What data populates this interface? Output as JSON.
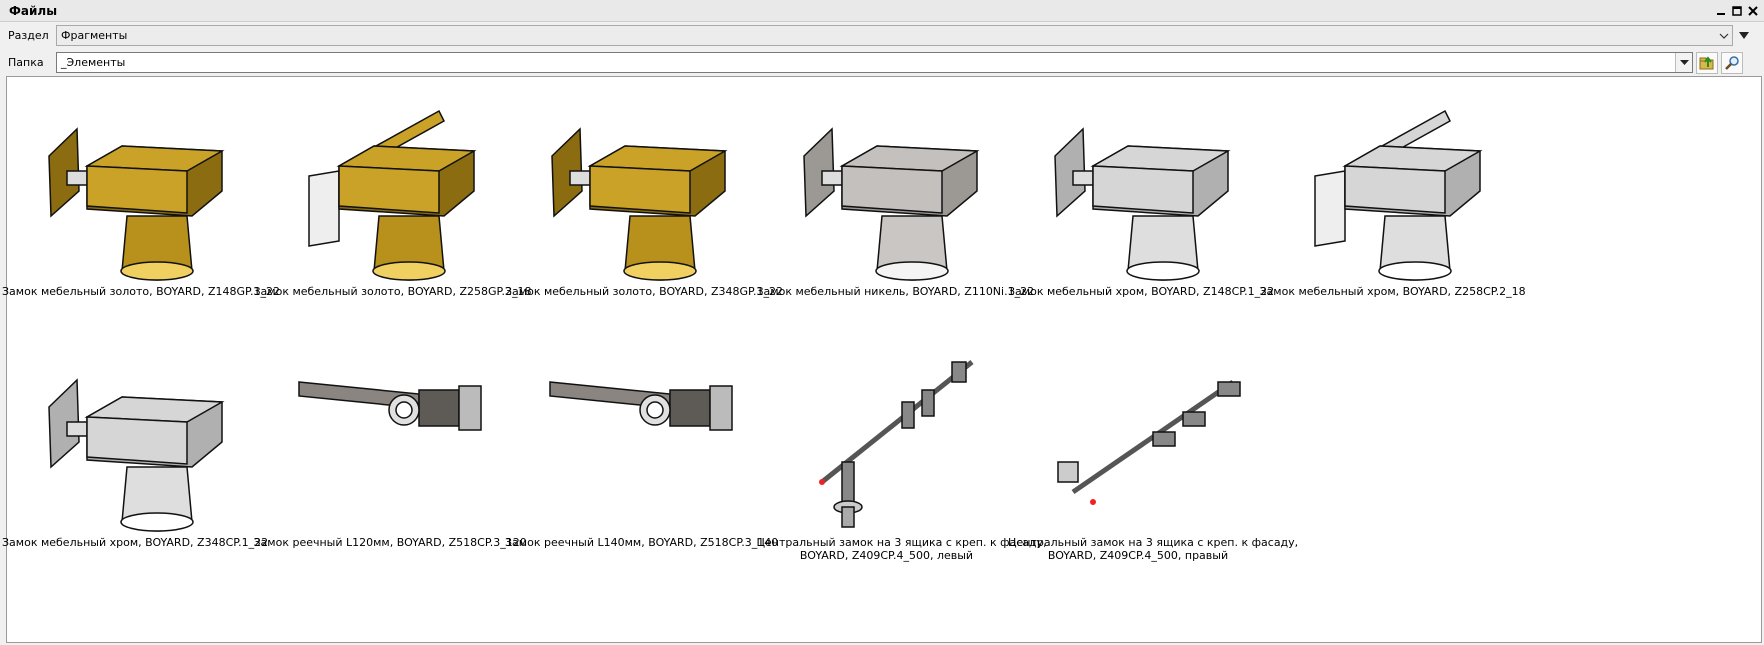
{
  "window": {
    "title": "Файлы"
  },
  "controls": {
    "section_label": "Раздел",
    "section_value": "Фрагменты",
    "folder_label": "Папка",
    "folder_value": "_Элементы"
  },
  "colors": {
    "gold": "#c9a227",
    "gold_dark": "#8c6c10",
    "chrome": "#d6d6d6",
    "nickel": "#c4c0bd",
    "steel": "#8a8580"
  },
  "icons": [
    "minimize-icon",
    "maximize-icon",
    "close-icon",
    "dropdown-arrow-icon",
    "folder-up-icon",
    "search-icon"
  ],
  "items": [
    {
      "caption": "Замок мебельный золото, BOYARD, Z148GP.1_22",
      "variant": "lock-small",
      "finish": "gold"
    },
    {
      "caption": "Замок мебельный золото, BOYARD, Z258GP.2_18",
      "variant": "lock-wide",
      "finish": "gold"
    },
    {
      "caption": "Замок мебельный золото, BOYARD, Z348GP.1_22",
      "variant": "lock-plate",
      "finish": "gold"
    },
    {
      "caption": "Замок мебельный никель, BOYARD, Z110Ni.1_22",
      "variant": "lock-small",
      "finish": "nickel"
    },
    {
      "caption": "Замок мебельный хром, BOYARD, Z148CP.1_22",
      "variant": "lock-small",
      "finish": "chrome"
    },
    {
      "caption": "Замок мебельный хром, BOYARD, Z258CP.2_18",
      "variant": "lock-wide",
      "finish": "chrome"
    },
    {
      "caption": "Замок мебельный хром, BOYARD, Z348CP.1_22",
      "variant": "lock-plate",
      "finish": "chrome"
    },
    {
      "caption": "Замок реечный L120мм, BOYARD, Z518CP.3_120",
      "variant": "rack",
      "finish": "steel"
    },
    {
      "caption": "Замок реечный L140мм, BOYARD, Z518CP.3_140",
      "variant": "rack",
      "finish": "steel"
    },
    {
      "caption": "Центральный замок на 3 ящика с креп. к фасаду,",
      "caption2": "BOYARD, Z409CP.4_500, левый",
      "variant": "central-left",
      "finish": "steel"
    },
    {
      "caption": "Центральный замок на 3 ящика с креп. к фасаду,",
      "caption2": "BOYARD, Z409CP.4_500, правый",
      "variant": "central-right",
      "finish": "steel"
    }
  ]
}
